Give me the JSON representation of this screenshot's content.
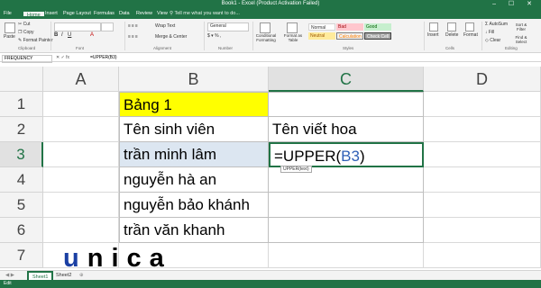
{
  "window": {
    "title": "Book1 - Excel (Product Activation Failed)",
    "controls": "–  ☐  ✕"
  },
  "tabs": [
    "File",
    "Home",
    "Insert",
    "Page Layout",
    "Formulas",
    "Data",
    "Review",
    "View"
  ],
  "tell_me": "Tell me what you want to do...",
  "ribbon": {
    "clipboard": {
      "cut": "Cut",
      "copy": "Copy",
      "format_painter": "Format Painter",
      "paste": "Paste",
      "group": "Clipboard"
    },
    "font": {
      "group": "Font"
    },
    "alignment": {
      "wrap_text": "Wrap Text",
      "merge_center": "Merge & Center",
      "group": "Alignment"
    },
    "number": {
      "format": "General",
      "group": "Number"
    },
    "styles": {
      "conditional": "Conditional Formatting",
      "format_as_table": "Format as Table",
      "cells": [
        "Normal",
        "Bad",
        "Good",
        "Neutral",
        "Calculation",
        "Check Cell"
      ],
      "group": "Styles"
    },
    "cells": {
      "insert": "Insert",
      "delete": "Delete",
      "format": "Format",
      "group": "Cells"
    },
    "editing": {
      "autosum": "AutoSum",
      "fill": "Fill",
      "clear": "Clear",
      "sort_filter": "Sort & Filter",
      "find_select": "Find & Select",
      "group": "Editing"
    }
  },
  "formula_bar": {
    "name_box": "FREQUENCY",
    "icons": "✕ ✓ fx",
    "formula": "=UPPER(B3)"
  },
  "columns": [
    "A",
    "B",
    "C",
    "D"
  ],
  "rows": [
    "1",
    "2",
    "3",
    "4",
    "5",
    "6",
    "7"
  ],
  "cells": {
    "B1": "Bảng 1",
    "B2": "Tên sinh viên",
    "C2": "Tên viết hoa",
    "B3": "trần minh lâm",
    "C3_prefix": "=UPPER(",
    "C3_ref": "B3",
    "C3_suffix": ")",
    "B4": "nguyễn hà an",
    "B5": "nguyễn bảo khánh",
    "B6": "trần văn khanh"
  },
  "tooltip": "UPPER(text)",
  "sheets": [
    "Sheet1",
    "Sheet2"
  ],
  "status": "Edit",
  "logo": {
    "letters": [
      "u",
      "n",
      "i",
      "c",
      "a"
    ]
  },
  "colors": {
    "excel_green": "#217346",
    "highlight_yellow": "#ffff00",
    "selection_blue": "#dce6f1",
    "ref_blue": "#2f5fb6",
    "logo_blue": "#1a3fa3"
  }
}
